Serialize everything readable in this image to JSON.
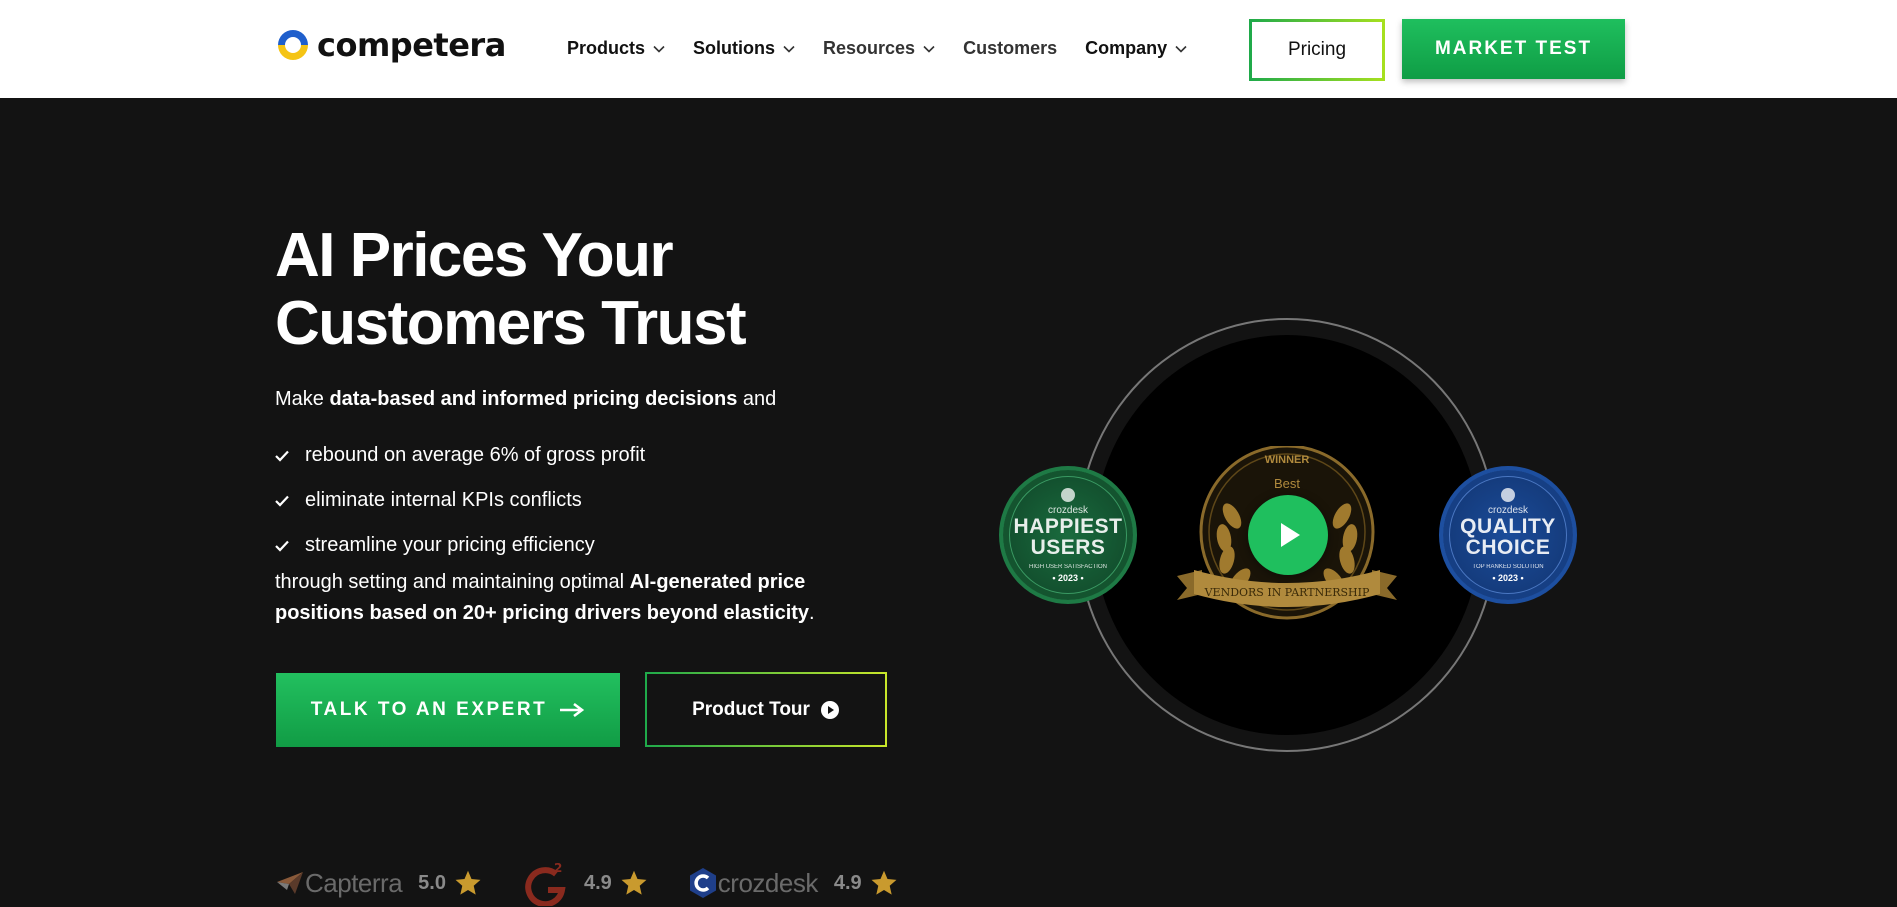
{
  "brand": {
    "logo_text": "competera"
  },
  "nav": {
    "items": [
      {
        "label": "Products",
        "dropdown": true
      },
      {
        "label": "Solutions",
        "dropdown": true
      },
      {
        "label": "Resources",
        "dropdown": true
      },
      {
        "label": "Customers",
        "dropdown": false
      },
      {
        "label": "Company",
        "dropdown": true
      }
    ],
    "pricing_label": "Pricing",
    "market_test_label": "MARKET TEST"
  },
  "hero": {
    "title_line1": "AI Prices Your",
    "title_line2": "Customers Trust",
    "intro_prefix": "Make ",
    "intro_bold": "data-based and informed pricing decisions",
    "intro_suffix": " and",
    "checks": [
      "rebound on average 6% of gross profit",
      "eliminate internal KPIs conflicts",
      "streamline your pricing efficiency"
    ],
    "outro_prefix": "through setting and maintaining optimal ",
    "outro_bold": "AI-generated price positions based on 20+ pricing drivers beyond elasticity",
    "outro_suffix": ".",
    "cta_expert": "TALK TO AN EXPERT",
    "cta_tour": "Product Tour"
  },
  "badges": {
    "left": {
      "brand": "crozdesk",
      "line1": "HAPPIEST",
      "line2": "USERS",
      "small": "HIGH USER SATISFACTION",
      "year": "• 2023 •"
    },
    "right": {
      "brand": "crozdesk",
      "line1": "QUALITY",
      "line2": "CHOICE",
      "small": "TOP RANKED SOLUTION",
      "year": "• 2023 •"
    },
    "award": {
      "top": "WINNER",
      "mid": "Best",
      "ribbon": "VENDORS IN PARTNERSHIP"
    }
  },
  "ratings": [
    {
      "brand": "Capterra",
      "score": "5.0",
      "icon": "capterra-icon"
    },
    {
      "brand": "",
      "score": "4.9",
      "icon": "g2-icon"
    },
    {
      "brand": "crozdesk",
      "score": "4.9",
      "icon": "crozdesk-icon"
    }
  ],
  "colors": {
    "accent_green": "#1fbf5e",
    "lime": "#a6e01f",
    "background_dark": "#131313",
    "star_gold": "#c99a2e"
  }
}
